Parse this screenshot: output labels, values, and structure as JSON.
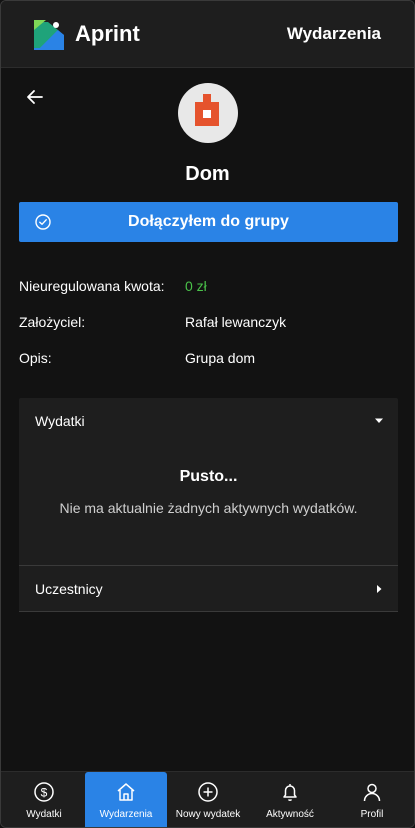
{
  "header": {
    "app_title": "Aprint",
    "nav_link": "Wydarzenia"
  },
  "group": {
    "name": "Dom",
    "join_button": "Dołączyłem do grupy"
  },
  "info": {
    "unsettled_label": "Nieuregulowana kwota:",
    "unsettled_value": "0 zł",
    "founder_label": "Założyciel:",
    "founder_value": "Rafał lewanczyk",
    "description_label": "Opis:",
    "description_value": "Grupa dom"
  },
  "expenses_panel": {
    "title": "Wydatki",
    "empty_title": "Pusto...",
    "empty_description": "Nie ma aktualnie żadnych aktywnych wydatków."
  },
  "members_panel": {
    "title": "Uczestnicy"
  },
  "bottom_nav": {
    "items": [
      {
        "label": "Wydatki",
        "icon": "dollar-circle-icon"
      },
      {
        "label": "Wydarzenia",
        "icon": "home-icon",
        "active": true
      },
      {
        "label": "Nowy wydatek",
        "icon": "plus-circle-icon"
      },
      {
        "label": "Aktywność",
        "icon": "bell-icon"
      },
      {
        "label": "Profil",
        "icon": "user-icon"
      }
    ]
  },
  "colors": {
    "accent": "#2a83e6",
    "background": "#121212",
    "surface": "#1e1e1e",
    "positive": "#4ac24a",
    "avatar_pattern": "#e5532d"
  }
}
